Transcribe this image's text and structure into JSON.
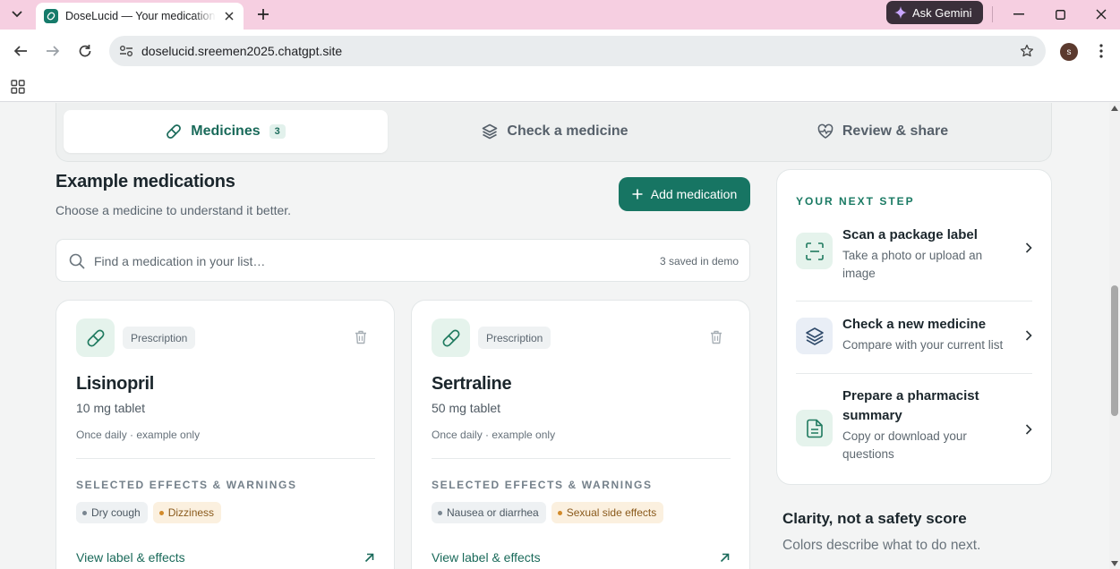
{
  "browser": {
    "tab_title": "DoseLucid — Your medications",
    "url": "doselucid.sreemen2025.chatgpt.site",
    "gemini_label": "Ask Gemini",
    "profile_initial": "s"
  },
  "nav": {
    "tabs": [
      {
        "label": "Medicines",
        "badge": "3",
        "icon": "pill-icon",
        "active": true
      },
      {
        "label": "Check a medicine",
        "icon": "layers-icon",
        "active": false
      },
      {
        "label": "Review & share",
        "icon": "heart-pulse-icon",
        "active": false
      }
    ]
  },
  "header": {
    "title": "Example medications",
    "subtitle": "Choose a medicine to understand it better.",
    "add_button": "Add medication"
  },
  "search": {
    "placeholder": "Find a medication in your list…",
    "count": "3 saved in demo"
  },
  "medications": [
    {
      "tag": "Prescription",
      "name": "Lisinopril",
      "dose": "10 mg tablet",
      "frequency": "Once daily · example only",
      "effects_label": "SELECTED EFFECTS & WARNINGS",
      "effects": [
        {
          "label": "Dry cough",
          "kind": "grey"
        },
        {
          "label": "Dizziness",
          "kind": "warn"
        }
      ],
      "link": "View label & effects"
    },
    {
      "tag": "Prescription",
      "name": "Sertraline",
      "dose": "50 mg tablet",
      "frequency": "Once daily · example only",
      "effects_label": "SELECTED EFFECTS & WARNINGS",
      "effects": [
        {
          "label": "Nausea or diarrhea",
          "kind": "grey"
        },
        {
          "label": "Sexual side effects",
          "kind": "warn"
        }
      ],
      "link": "View label & effects"
    }
  ],
  "next_step": {
    "eyebrow": "YOUR NEXT STEP",
    "steps": [
      {
        "title": "Scan a package label",
        "desc": "Take a photo or upload an image",
        "icon": "scan-icon"
      },
      {
        "title": "Check a new medicine",
        "desc": "Compare with your current list",
        "icon": "layers-icon"
      },
      {
        "title": "Prepare a pharmacist summary",
        "desc": "Copy or download your questions",
        "icon": "document-icon"
      }
    ]
  },
  "clarity": {
    "title": "Clarity, not a safety score",
    "subtitle": "Colors describe what to do next."
  },
  "colors": {
    "brand": "#177563",
    "tabstrip": "#f6cfe1",
    "warn_chip": "#fbf0df"
  }
}
